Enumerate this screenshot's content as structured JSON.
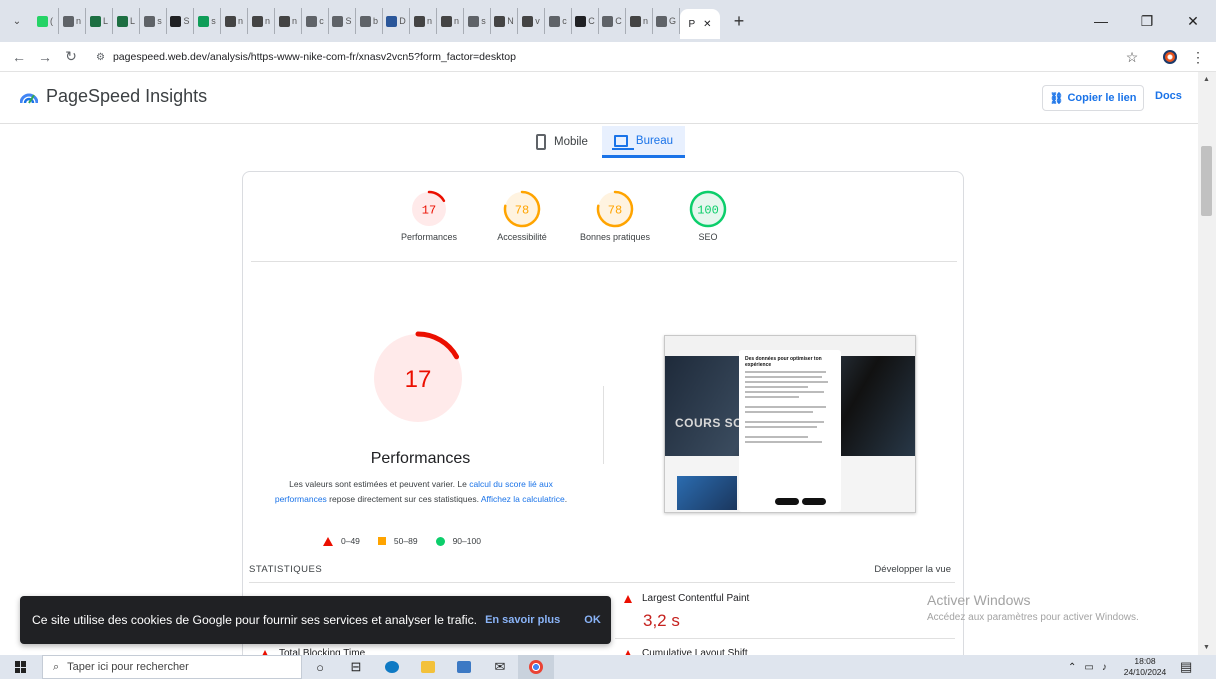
{
  "browser": {
    "tabs": [
      {
        "letter": "(",
        "icon": "whatsapp-icon",
        "color": "#25d366"
      },
      {
        "letter": "n",
        "icon": "search-icon",
        "color": "#5f6368"
      },
      {
        "letter": "L",
        "icon": "excel-icon",
        "color": "#1d6f42"
      },
      {
        "letter": "L",
        "icon": "excel-icon",
        "color": "#1d6f42"
      },
      {
        "letter": "s",
        "icon": "search-icon",
        "color": "#5f6368"
      },
      {
        "letter": "S",
        "icon": "openai-icon",
        "color": "#202124"
      },
      {
        "letter": "s",
        "icon": "app-icon",
        "color": "#0f9d58"
      },
      {
        "letter": "n",
        "icon": "nike-icon",
        "color": "#444"
      },
      {
        "letter": "n",
        "icon": "nike-icon",
        "color": "#444"
      },
      {
        "letter": "n",
        "icon": "nike-icon",
        "color": "#444"
      },
      {
        "letter": "c",
        "icon": "search-icon",
        "color": "#5f6368"
      },
      {
        "letter": "S",
        "icon": "search-icon",
        "color": "#5f6368"
      },
      {
        "letter": "b",
        "icon": "search-icon",
        "color": "#5f6368"
      },
      {
        "letter": "D",
        "icon": "word-icon",
        "color": "#2b579a"
      },
      {
        "letter": "n",
        "icon": "nike-icon",
        "color": "#444"
      },
      {
        "letter": "n",
        "icon": "nike-icon",
        "color": "#444"
      },
      {
        "letter": "s",
        "icon": "search-icon",
        "color": "#5f6368"
      },
      {
        "letter": "N",
        "icon": "nike-icon",
        "color": "#444"
      },
      {
        "letter": "v",
        "icon": "nike-icon",
        "color": "#444"
      },
      {
        "letter": "c",
        "icon": "search-icon",
        "color": "#5f6368"
      },
      {
        "letter": "C",
        "icon": "app-icon",
        "color": "#202124"
      },
      {
        "letter": "C",
        "icon": "openai-icon",
        "color": "#5f6368"
      },
      {
        "letter": "n",
        "icon": "nike-icon",
        "color": "#444"
      },
      {
        "letter": "G",
        "icon": "search-icon",
        "color": "#5f6368"
      }
    ],
    "active_tab_label": "P",
    "url": "pagespeed.web.dev/analysis/https-www-nike-com-fr/xnasv2vcn5?form_factor=desktop"
  },
  "header": {
    "title": "PageSpeed Insights",
    "copy_link": "Copier le lien",
    "docs": "Docs"
  },
  "device_tabs": {
    "mobile": "Mobile",
    "desktop": "Bureau"
  },
  "scores": [
    {
      "value": "17",
      "label": "Performances",
      "color": "#eb0f00",
      "bg": "#ffeaea",
      "fraction": 0.17
    },
    {
      "value": "78",
      "label": "Accessibilité",
      "color": "#ffa400",
      "bg": "#fff3e0",
      "fraction": 0.78
    },
    {
      "value": "78",
      "label": "Bonnes pratiques",
      "color": "#ffa400",
      "bg": "#fff3e0",
      "fraction": 0.78
    },
    {
      "value": "100",
      "label": "SEO",
      "color": "#0cce6b",
      "bg": "#e6f7ee",
      "fraction": 1.0
    }
  ],
  "performance": {
    "score": "17",
    "fraction": 0.17,
    "title": "Performances",
    "desc_1": "Les valeurs sont estimées et peuvent varier. Le ",
    "desc_link_1": "calcul du score lié aux performances",
    "desc_2": " repose directement sur ces statistiques. ",
    "desc_link_2": "Affichez la calculatrice",
    "desc_3": ".",
    "legend": [
      "0–49",
      "50–89",
      "90–100"
    ]
  },
  "screenshot_preview": {
    "hero_text": "COURS SOU",
    "modal_title": "Des données pour optimiser ton expérience"
  },
  "stats": {
    "label": "STATISTIQUES",
    "expand": "Développer la vue",
    "lcp_name": "Largest Contentful Paint",
    "lcp_value": "3,2 s",
    "tbt_name": "Total Blocking Time",
    "cls_name": "Cumulative Layout Shift"
  },
  "cookie": {
    "text": "Ce site utilise des cookies de Google pour fournir ses services et analyser le trafic.",
    "more": "En savoir plus",
    "ok": "OK"
  },
  "watermark": {
    "line1": "Activer Windows",
    "line2": "Accédez aux paramètres pour activer Windows."
  },
  "taskbar": {
    "search_placeholder": "Taper ici pour rechercher",
    "time": "18:08",
    "date": "24/10/2024"
  }
}
